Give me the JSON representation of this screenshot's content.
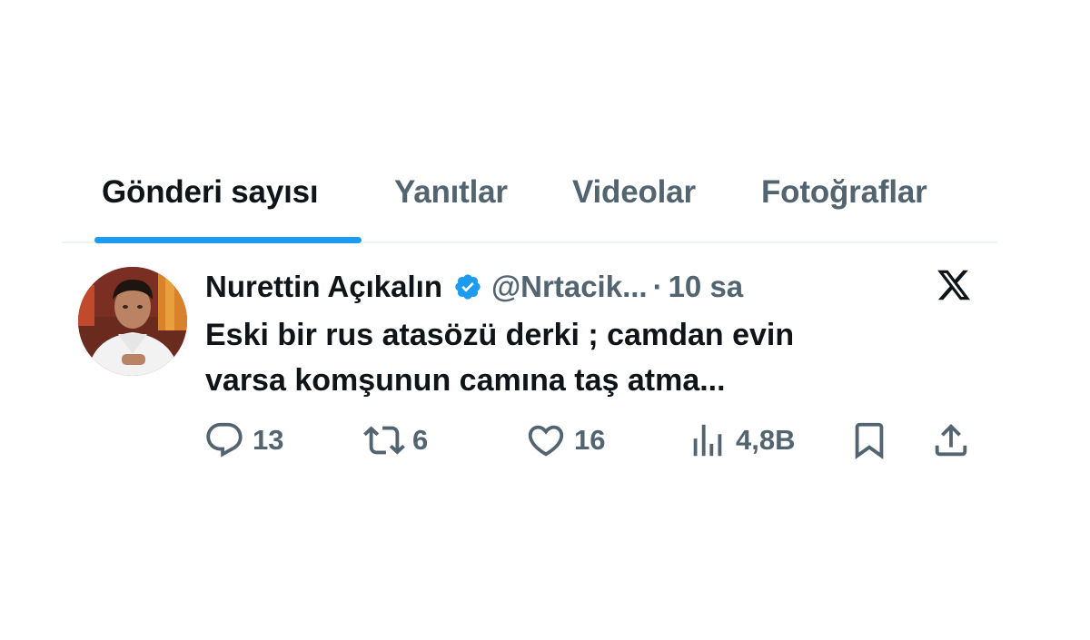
{
  "tabs": [
    {
      "label": "Gönderi sayısı",
      "active": true
    },
    {
      "label": "Yanıtlar",
      "active": false
    },
    {
      "label": "Videolar",
      "active": false
    },
    {
      "label": "Fotoğraflar",
      "active": false
    }
  ],
  "tweet": {
    "author_name": "Nurettin Açıkalın",
    "handle": "@Nrtacik...",
    "separator": "·",
    "time": "10 sa",
    "text_line1": "Eski bir rus atasözü derki ; camdan evin",
    "text_line2": "varsa komşunun camına taş atma...",
    "actions": {
      "replies": "13",
      "reposts": "6",
      "likes": "16",
      "views": "4,8B"
    }
  },
  "colors": {
    "accent": "#1d9bf0",
    "text_primary": "#0f1419",
    "text_secondary": "#536471",
    "divider": "#eff3f4"
  },
  "icons": [
    "verified-badge-icon",
    "x-logo-icon",
    "reply-icon",
    "repost-icon",
    "like-icon",
    "views-icon",
    "bookmark-icon",
    "share-icon"
  ]
}
